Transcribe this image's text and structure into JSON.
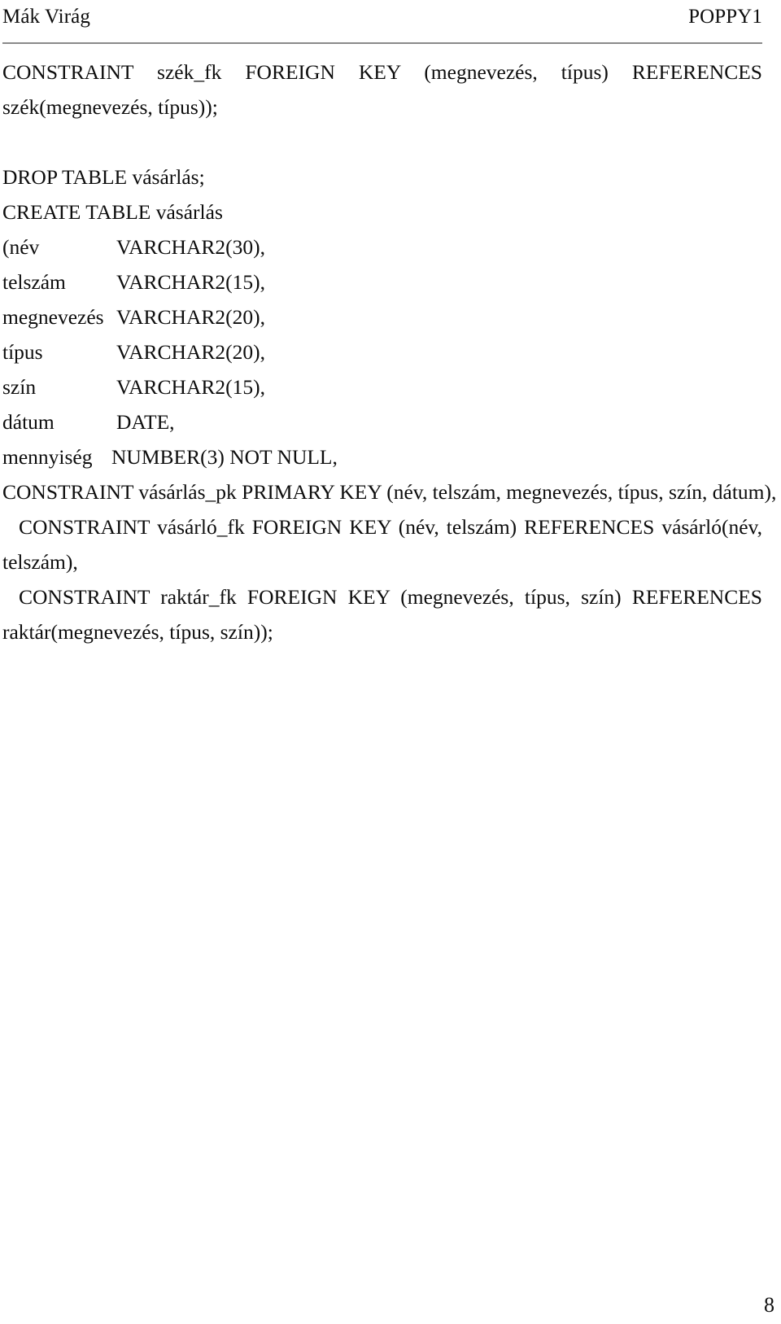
{
  "page": {
    "running_header": {
      "left": "Mák Virág",
      "right": "POPPY1"
    },
    "page_number": "8",
    "rule_color": "#8a8a8a",
    "text_color": "#0d0d0d",
    "background_color": "#ffffff"
  },
  "body": {
    "paragraph_1": "CONSTRAINT szék_fk FOREIGN KEY (megnevezés, típus) REFERENCES szék(megnevezés, típus));",
    "drop_table": "DROP TABLE vásárlás;",
    "create_table": "CREATE TABLE vásárlás",
    "column_definitions": [
      {
        "name": "(név",
        "type": "VARCHAR2(30),"
      },
      {
        "name": "telszám",
        "type": "VARCHAR2(15),"
      },
      {
        "name": "megnevezés",
        "type": "VARCHAR2(20),"
      },
      {
        "name": "típus",
        "type": "VARCHAR2(20),"
      },
      {
        "name": "szín",
        "type": "VARCHAR2(15),"
      },
      {
        "name": "dátum",
        "type": "DATE,"
      },
      {
        "name": "mennyiség",
        "type": "NUMBER(3) NOT NULL,"
      }
    ],
    "constraint_pk": "CONSTRAINT vásárlás_pk PRIMARY KEY (név, telszám, megnevezés, típus, szín, dátum),",
    "constraint_fk_vasarlo": "CONSTRAINT vásárló_fk FOREIGN KEY (név, telszám) REFERENCES vásárló(név, telszám),",
    "constraint_fk_raktar": "CONSTRAINT raktár_fk FOREIGN KEY (megnevezés, típus, szín) REFERENCES raktár(megnevezés, típus, szín));"
  }
}
